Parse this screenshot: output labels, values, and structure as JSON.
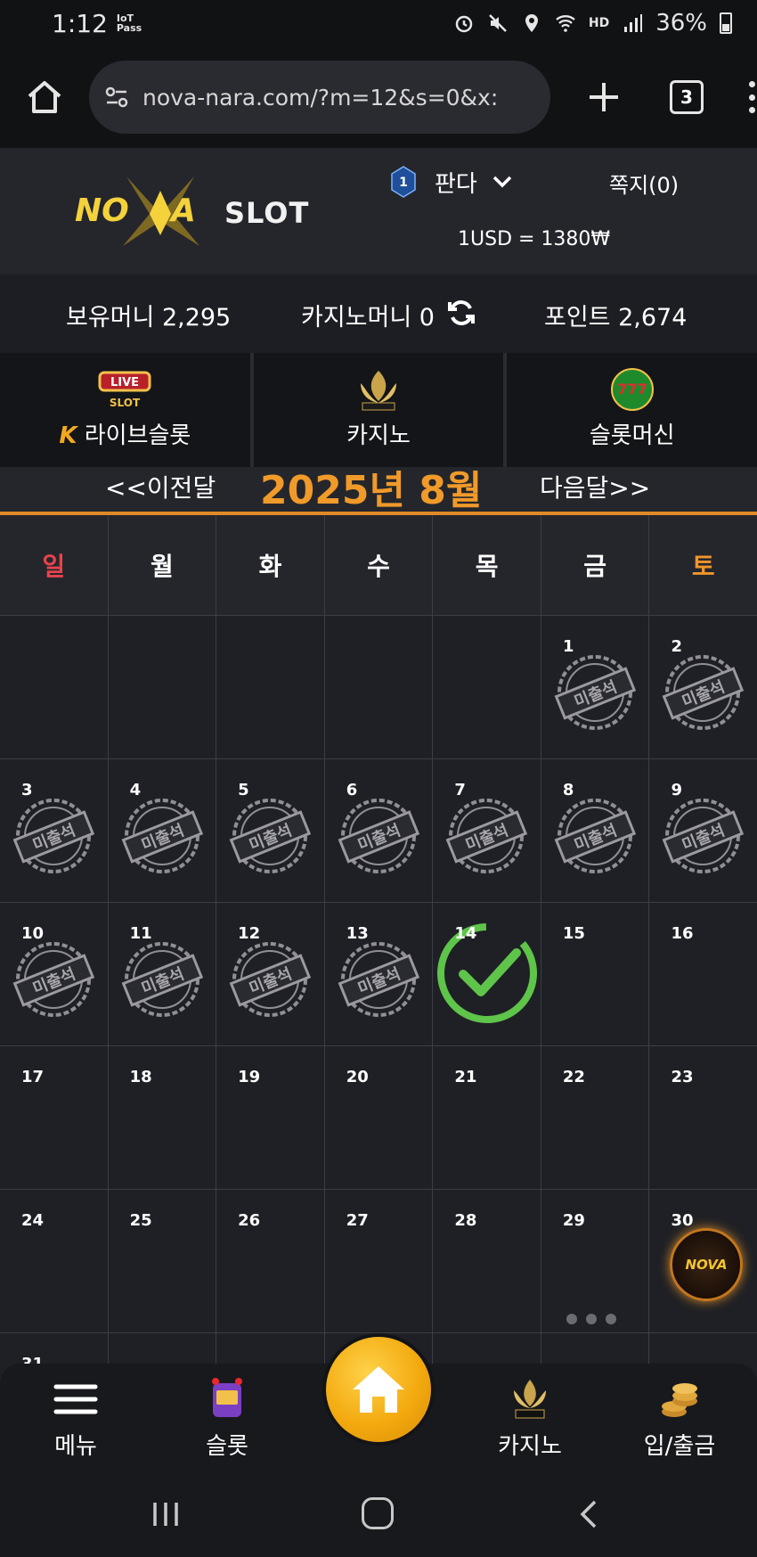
{
  "status": {
    "time": "1:12",
    "iot": "IoT\nPass",
    "battery": "36%",
    "network": "HD"
  },
  "browser": {
    "url": "nova-nara.com/?m=12&s=0&x:",
    "tab_count": "3"
  },
  "header": {
    "logo_nova": "NOVA",
    "logo_slot": "SLOT",
    "user_level": "1",
    "user_name": "판다",
    "message_link": "쪽지(0)",
    "exchange_rate": "1USD = 1380₩"
  },
  "money": {
    "holding": "보유머니 2,295",
    "casino": "카지노머니 0",
    "points": "포인트 2,674"
  },
  "game_tabs": [
    {
      "label": "라이브슬롯",
      "icon": "live-slot-icon",
      "prefix": "K"
    },
    {
      "label": "카지노",
      "icon": "k-slot-icon"
    },
    {
      "label": "슬롯머신",
      "icon": "777-slots-icon"
    }
  ],
  "month_nav": {
    "prev": "<<이전달",
    "title": "2025년 8월",
    "next": "다음달>>"
  },
  "weekdays": [
    "일",
    "월",
    "화",
    "수",
    "목",
    "금",
    "토"
  ],
  "weekday_colors": {
    "sunday": "#e8434c",
    "saturday": "#f0952b",
    "weekday": "#ffffff"
  },
  "stamp_text": "미출석",
  "calendar": {
    "rows": [
      [
        "",
        "",
        "",
        "",
        "",
        "1",
        "2"
      ],
      [
        "3",
        "4",
        "5",
        "6",
        "7",
        "8",
        "9"
      ],
      [
        "10",
        "11",
        "12",
        "13",
        "14",
        "15",
        "16"
      ],
      [
        "17",
        "18",
        "19",
        "20",
        "21",
        "22",
        "23"
      ],
      [
        "24",
        "25",
        "26",
        "27",
        "28",
        "29",
        "30"
      ],
      [
        "31",
        "",
        "",
        "",
        "",
        "",
        ""
      ]
    ],
    "absent_days": [
      "1",
      "2",
      "3",
      "4",
      "5",
      "6",
      "7",
      "8",
      "9",
      "10",
      "11",
      "12",
      "13"
    ],
    "checked_day": "14"
  },
  "fab": {
    "label": "NOVA"
  },
  "bottom_nav": {
    "menu": "메뉴",
    "slot": "슬롯",
    "casino": "카지노",
    "deposit": "입/출금"
  }
}
